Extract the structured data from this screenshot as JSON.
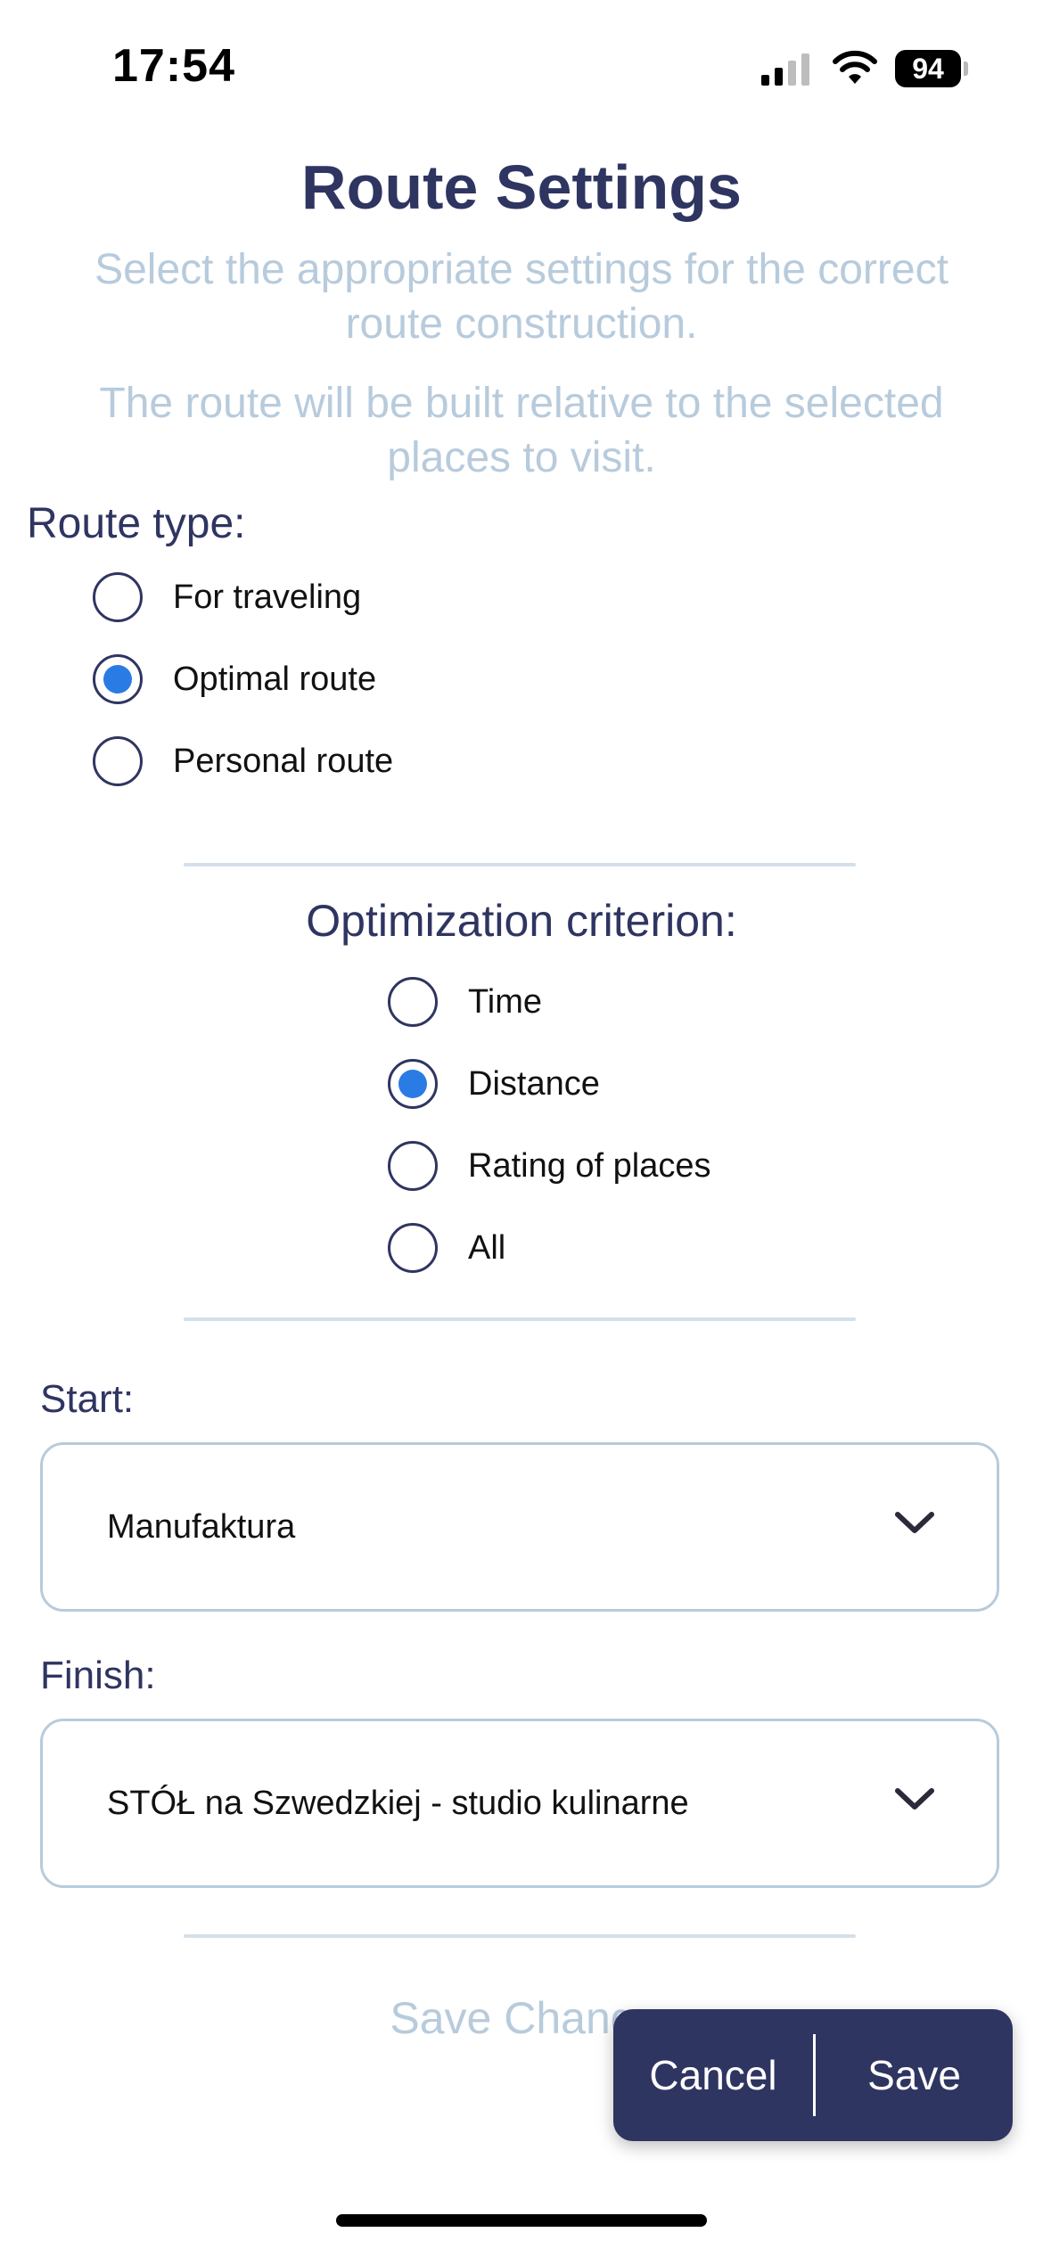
{
  "status_bar": {
    "time": "17:54",
    "battery": "94",
    "icons": [
      "signal-icon",
      "wifi-icon",
      "battery-icon"
    ]
  },
  "header": {
    "title": "Route Settings",
    "subtitle_1": "Select the appropriate settings for the correct route construction.",
    "subtitle_2": "The route will be built relative to the selected places to visit."
  },
  "route_type": {
    "label": "Route type:",
    "options": [
      {
        "label": "For traveling",
        "selected": false
      },
      {
        "label": "Optimal route",
        "selected": true
      },
      {
        "label": "Personal route",
        "selected": false
      }
    ]
  },
  "optimization": {
    "label": "Optimization criterion:",
    "options": [
      {
        "label": "Time",
        "selected": false
      },
      {
        "label": "Distance",
        "selected": true
      },
      {
        "label": "Rating of places",
        "selected": false
      },
      {
        "label": "All",
        "selected": false
      }
    ]
  },
  "start": {
    "label": "Start:",
    "value": "Manufaktura"
  },
  "finish": {
    "label": "Finish:",
    "value": "STÓŁ na Szwedzkiej - studio kulinarne"
  },
  "save_changes": {
    "label": "Save Chang"
  },
  "popup": {
    "cancel_label": "Cancel",
    "save_label": "Save"
  },
  "colors": {
    "primary": "#2f3561",
    "accent": "#2b7be4",
    "muted": "#b7cbdc",
    "divider": "#d4e0ea"
  }
}
